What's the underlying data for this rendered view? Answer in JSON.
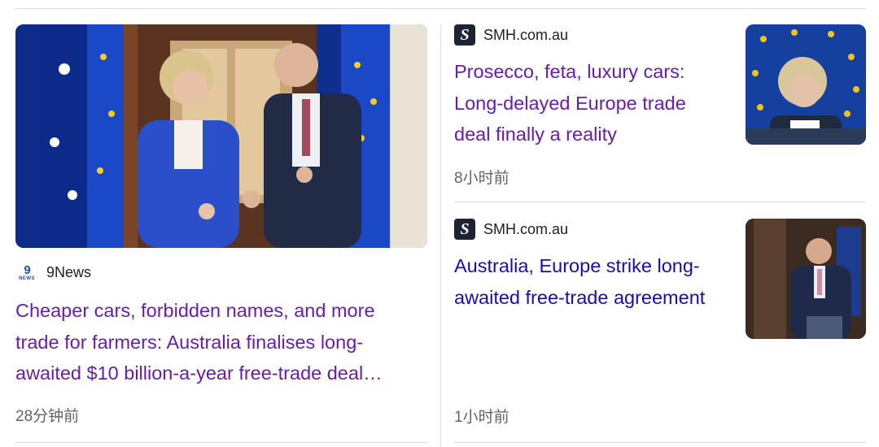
{
  "left_article": {
    "source": "9News",
    "source_logo_icon": "nine-news-logo-icon",
    "headline": "Cheaper cars, forbidden names, and more trade for farmers: Australia finalises long-awaited $10 billion-a-year free-trade deal…",
    "time": "28分钟前",
    "visited": true
  },
  "right_articles": [
    {
      "source": "SMH.com.au",
      "source_logo_icon": "smh-logo-icon",
      "headline": "Prosecco, feta, luxury cars: Long-delayed Europe trade deal finally a reality",
      "time": "8小时前",
      "visited": true
    },
    {
      "source": "SMH.com.au",
      "source_logo_icon": "smh-logo-icon",
      "headline": "Australia, Europe strike long-awaited free-trade agreement",
      "time": "1小时前",
      "visited": false
    }
  ],
  "colors": {
    "visited_link": "#681da8",
    "unvisited_link": "#1a0dab",
    "meta_text": "#5f6368",
    "divider": "#dadce0"
  },
  "logos": {
    "smh_letter": "S",
    "nine_numeral": "9",
    "nine_word": "NEWS"
  }
}
